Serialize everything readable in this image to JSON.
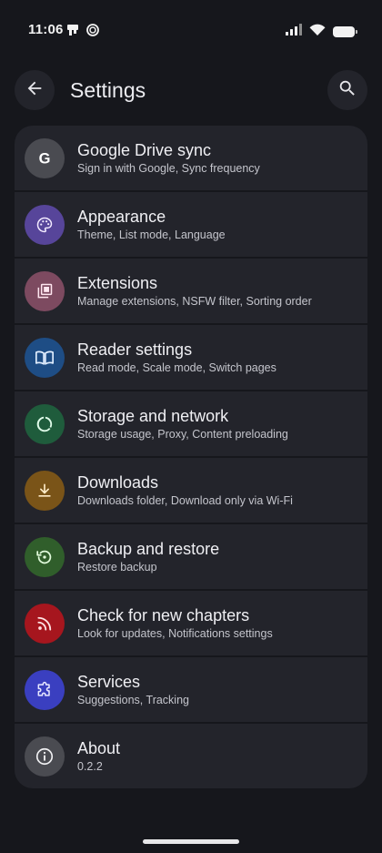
{
  "status_bar": {
    "time": "11:06",
    "icons": [
      "notification-app-icon",
      "notification-circle-icon",
      "signal-icon",
      "wifi-icon",
      "battery-icon"
    ]
  },
  "app_bar": {
    "title": "Settings",
    "back_icon": "arrow-left-icon",
    "search_icon": "search-icon"
  },
  "settings": [
    {
      "title": "Google Drive sync",
      "subtitle": "Sign in with Google, Sync frequency",
      "icon": "google-g-icon",
      "color": "#4a4b51"
    },
    {
      "title": "Appearance",
      "subtitle": "Theme, List mode, Language",
      "icon": "palette-icon",
      "color": "#57459a"
    },
    {
      "title": "Extensions",
      "subtitle": "Manage extensions, NSFW filter, Sorting order",
      "icon": "extensions-library-icon",
      "color": "#7d4a60"
    },
    {
      "title": "Reader settings",
      "subtitle": "Read mode, Scale mode, Switch pages",
      "icon": "book-open-icon",
      "color": "#1e4d85"
    },
    {
      "title": "Storage and network",
      "subtitle": "Storage usage, Proxy, Content preloading",
      "icon": "data-usage-icon",
      "color": "#1f5c3c"
    },
    {
      "title": "Downloads",
      "subtitle": "Downloads folder, Download only via Wi-Fi",
      "icon": "download-icon",
      "color": "#7a5418"
    },
    {
      "title": "Backup and restore",
      "subtitle": "Restore backup",
      "icon": "settings-backup-restore-icon",
      "color": "#305e2b"
    },
    {
      "title": "Check for new chapters",
      "subtitle": "Look for updates, Notifications settings",
      "icon": "rss-feed-icon",
      "color": "#a6161e"
    },
    {
      "title": "Services",
      "subtitle": "Suggestions, Tracking",
      "icon": "extension-puzzle-icon",
      "color": "#3a3fc0"
    },
    {
      "title": "About",
      "subtitle": "0.2.2",
      "icon": "info-icon",
      "color": "#4a4b51"
    }
  ],
  "colors": {
    "background": "#16171c",
    "surface": "#23242b",
    "text_primary": "#efeff3",
    "text_secondary": "#c4c5cc"
  }
}
